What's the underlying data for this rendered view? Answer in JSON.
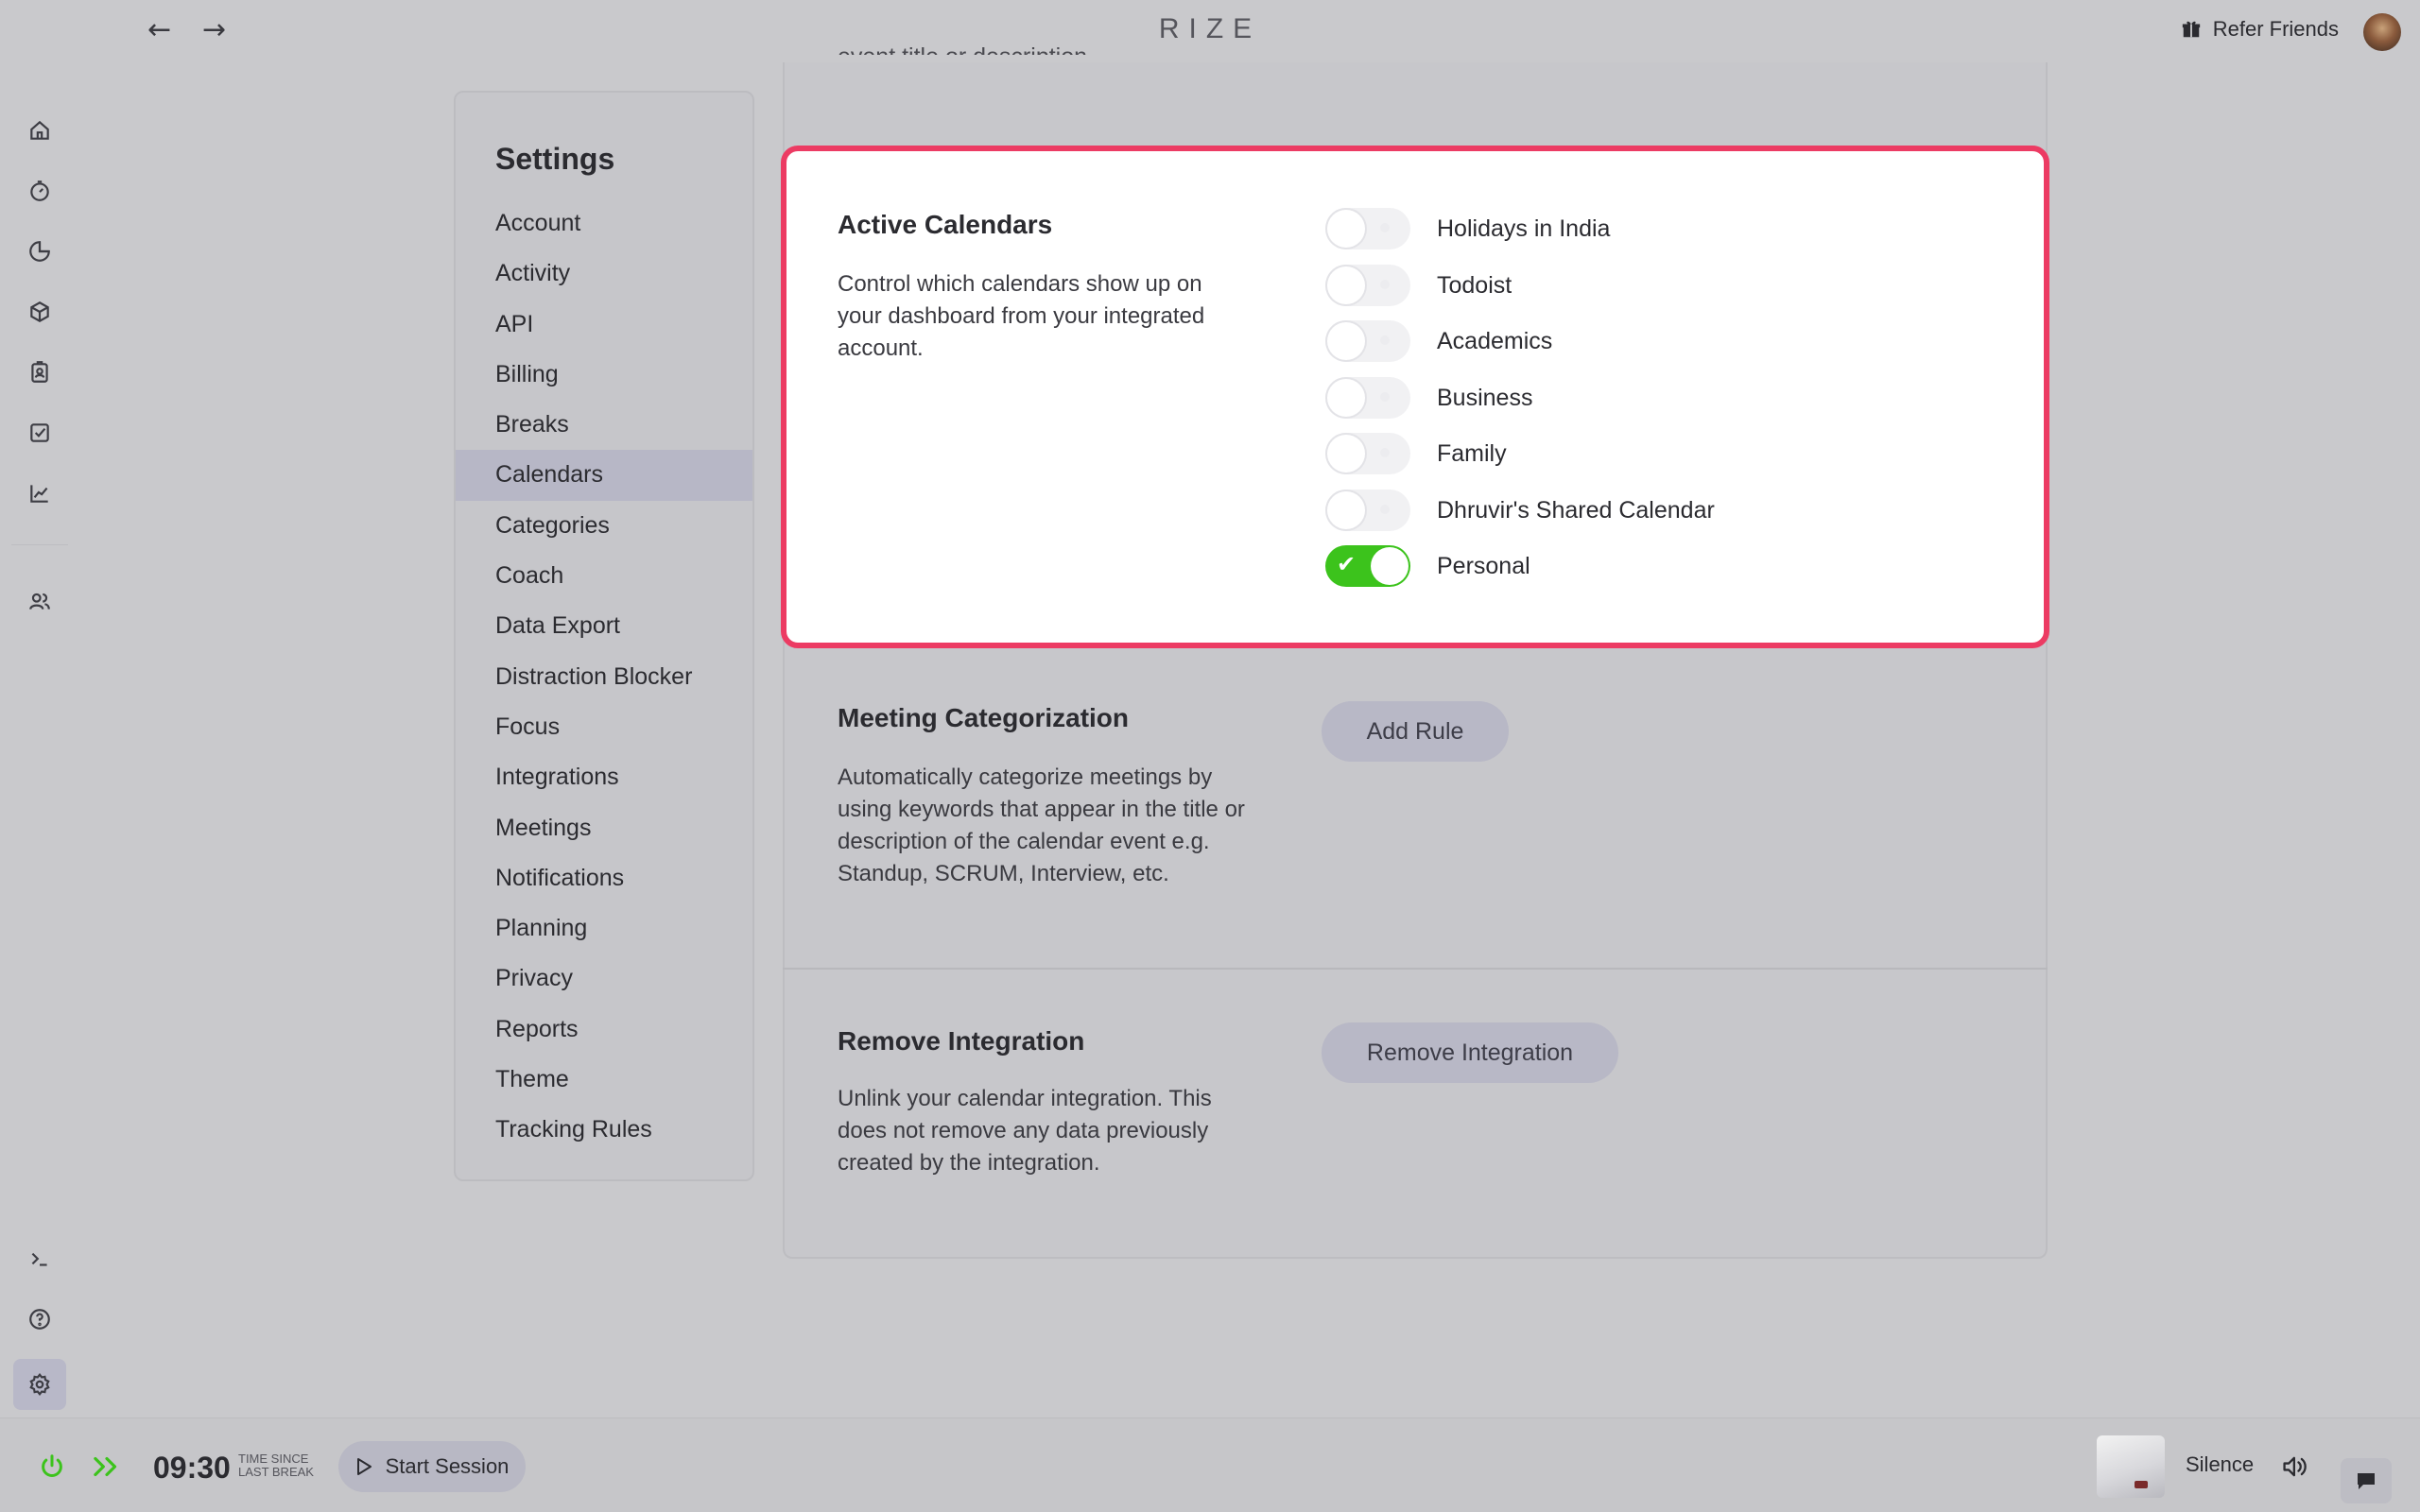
{
  "app": {
    "logo": "RIZE",
    "refer_label": "Refer Friends"
  },
  "settings": {
    "title": "Settings",
    "items": [
      "Account",
      "Activity",
      "API",
      "Billing",
      "Breaks",
      "Calendars",
      "Categories",
      "Coach",
      "Data Export",
      "Distraction Blocker",
      "Focus",
      "Integrations",
      "Meetings",
      "Notifications",
      "Planning",
      "Privacy",
      "Reports",
      "Theme",
      "Tracking Rules"
    ],
    "active_item": "Calendars"
  },
  "clipped_top_text": "event title or description.",
  "active_calendars": {
    "title": "Active Calendars",
    "description": "Control which calendars show up on your dashboard from your integrated account.",
    "calendars": [
      {
        "name": "Holidays in India",
        "enabled": false
      },
      {
        "name": "Todoist",
        "enabled": false
      },
      {
        "name": "Academics",
        "enabled": false
      },
      {
        "name": "Business",
        "enabled": false
      },
      {
        "name": "Family",
        "enabled": false
      },
      {
        "name": "Dhruvir's Shared Calendar",
        "enabled": false
      },
      {
        "name": "Personal",
        "enabled": true
      }
    ],
    "highlight_color": "#ec3b63",
    "toggle_on_color": "#3cc31c"
  },
  "meeting_categorization": {
    "title": "Meeting Categorization",
    "description": "Automatically categorize meetings by using keywords that appear in the title or description of the calendar event e.g. Standup, SCRUM, Interview, etc.",
    "button": "Add Rule"
  },
  "remove_integration": {
    "title": "Remove Integration",
    "description": "Unlink your calendar integration. This does not remove any data previously created by the integration.",
    "button": "Remove Integration"
  },
  "bottom": {
    "time": "09:30",
    "time_caption_line1": "TIME SINCE",
    "time_caption_line2": "LAST BREAK",
    "start_session": "Start Session",
    "sound": "Silence"
  }
}
